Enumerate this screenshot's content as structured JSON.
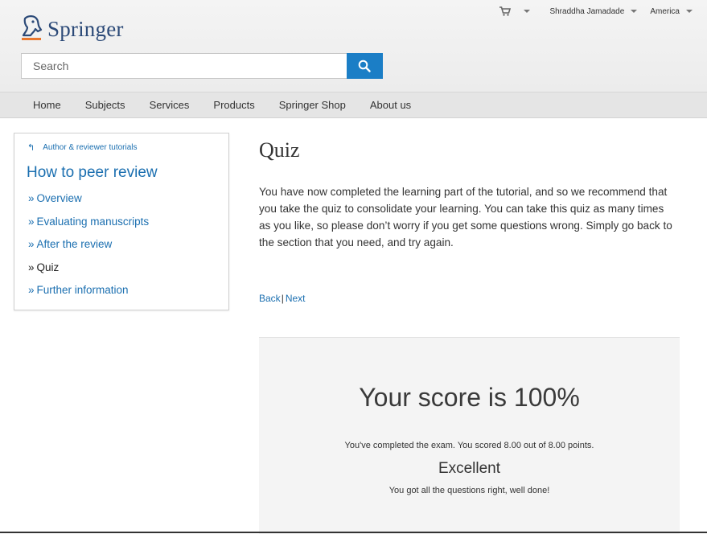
{
  "header": {
    "logo_text": "Springer",
    "user_name": "Shraddha Jamadade",
    "region": "America",
    "search_placeholder": "Search"
  },
  "nav": {
    "items": [
      "Home",
      "Subjects",
      "Services",
      "Products",
      "Springer Shop",
      "About us"
    ]
  },
  "sidebar": {
    "back_link": "Author & reviewer tutorials",
    "title": "How to peer review",
    "items": [
      {
        "label": "Overview",
        "prefix": "»"
      },
      {
        "label": "Evaluating manuscripts",
        "prefix": "»"
      },
      {
        "label": "After the review",
        "prefix": "»"
      },
      {
        "label": "Quiz",
        "prefix": "»"
      },
      {
        "label": "Further information",
        "prefix": "»"
      }
    ]
  },
  "main": {
    "title": "Quiz",
    "intro": "You have now completed the learning part of the tutorial, and so we recommend that you take the quiz to consolidate your learning. You can take this quiz as many times as you like, so please don’t worry if you get some questions wrong. Simply go back to the section that you need, and try again.",
    "back": "Back",
    "separator": "|",
    "next": "Next"
  },
  "result": {
    "score": "Your score is 100%",
    "completed": "You've completed the exam. You scored 8.00 out of 8.00 points.",
    "rating": "Excellent",
    "feedback": "You got all the questions right, well done!"
  },
  "icons": {
    "cart": "cart-icon",
    "search": "search-icon",
    "dropdown": "caret-down-icon",
    "back": "back-arrow-icon",
    "logo": "springer-horse-logo"
  },
  "colors": {
    "link": "#1b6fb0",
    "search_button": "#1b7ec6",
    "logo_text": "#2c4a78",
    "logo_accent": "#e8772e"
  }
}
